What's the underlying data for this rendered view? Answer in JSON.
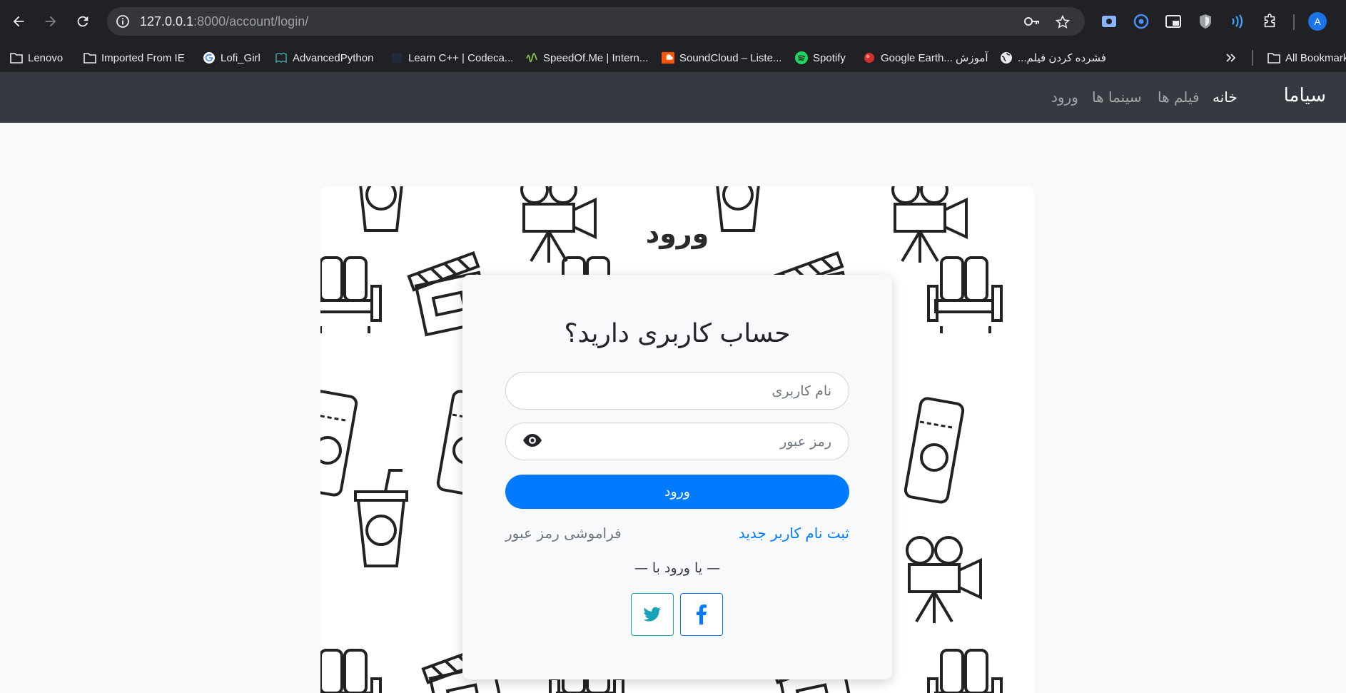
{
  "browser": {
    "url_host": "127.0.0.1",
    "url_rest": ":8000/account/login/",
    "avatar_letter": "A",
    "bookmarks": [
      {
        "label": "Lenovo",
        "icon": "folder-icon"
      },
      {
        "label": "Imported From IE",
        "icon": "folder-icon"
      },
      {
        "label": "Lofi_Girl",
        "icon": "google-icon"
      },
      {
        "label": "AdvancedPython",
        "icon": "site-icon"
      },
      {
        "label": "Learn C++ | Codeca...",
        "icon": "codecademy-icon"
      },
      {
        "label": "SpeedOf.Me | Intern...",
        "icon": "speedofme-icon"
      },
      {
        "label": "SoundCloud – Liste...",
        "icon": "soundcloud-icon"
      },
      {
        "label": "Spotify",
        "icon": "spotify-icon"
      },
      {
        "label": "آموزش ...Google Earth",
        "icon": "google-earth-icon"
      },
      {
        "label": "فشرده کردن فیلم...",
        "icon": "globe-icon"
      }
    ],
    "all_bookmarks_label": "All Bookmarks"
  },
  "site": {
    "brand": "سیاما",
    "nav": {
      "home": "خانه",
      "films": "فیلم ها",
      "cinemas": "سینما ها",
      "login": "ورود"
    }
  },
  "page": {
    "title": "ورود",
    "login_form": {
      "heading": "حساب کاربری دارید؟",
      "username_placeholder": "نام کاربری",
      "password_placeholder": "رمز عبور",
      "submit_label": "ورود",
      "register_link": "ثبت نام کاربر جدید",
      "forgot_link": "فراموشی رمز عبور",
      "or_login_with": "— یا ورود با —"
    }
  },
  "colors": {
    "primary": "#007bff",
    "navbar": "#343a40",
    "twitter": "#17a2b8",
    "chrome": "#202124"
  }
}
